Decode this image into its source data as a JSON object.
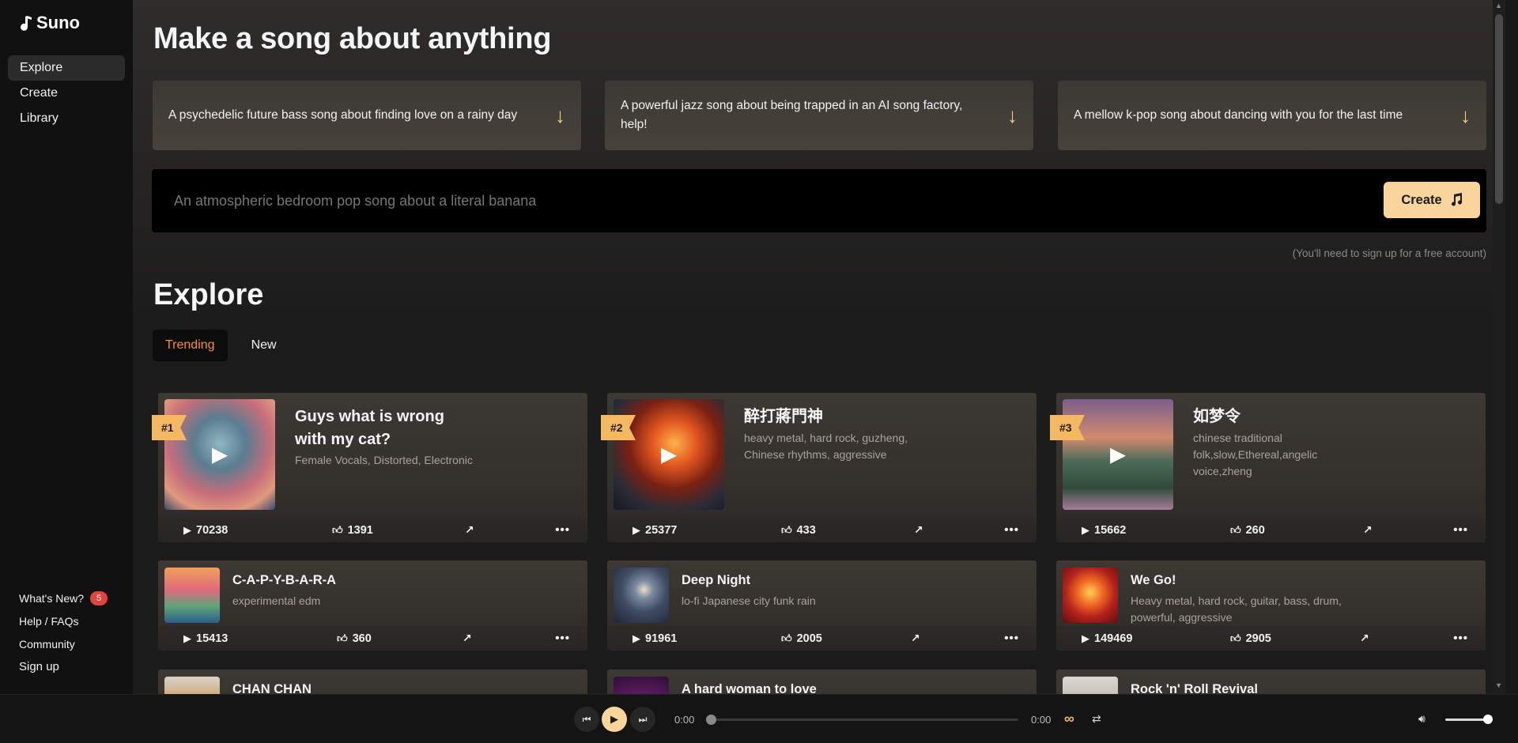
{
  "app": {
    "name": "Suno"
  },
  "sidebar": {
    "items": [
      {
        "label": "Explore",
        "active": true
      },
      {
        "label": "Create"
      },
      {
        "label": "Library"
      }
    ],
    "bottom": {
      "whats_new": "What's New?",
      "whats_new_count": "5",
      "help": "Help / FAQs",
      "community": "Community",
      "signup": "Sign up"
    }
  },
  "hero": {
    "title": "Make a song about anything",
    "prompts": [
      "A psychedelic future bass song about finding love on a rainy day",
      "A powerful jazz song about being trapped in an AI song factory, help!",
      "A mellow k-pop song about dancing with you for the last time"
    ],
    "input_placeholder": "An atmospheric bedroom pop song about a literal banana",
    "create_label": "Create",
    "signup_note": "(You'll need to sign up for a free account)"
  },
  "explore": {
    "title": "Explore",
    "tabs": [
      {
        "label": "Trending",
        "active": true
      },
      {
        "label": "New"
      }
    ],
    "featured": [
      {
        "rank": "#1",
        "title": "Guys what is wrong with my cat?",
        "tags": "Female Vocals, Distorted, Electronic",
        "plays": "70238",
        "likes": "1391"
      },
      {
        "rank": "#2",
        "title": "醉打蔣門神",
        "tags": "heavy metal, hard rock, guzheng, Chinese rhythms, aggressive",
        "plays": "25377",
        "likes": "433"
      },
      {
        "rank": "#3",
        "title": "如梦令",
        "tags": "chinese traditional folk,slow,Ethereal,angelic voice,zheng",
        "plays": "15662",
        "likes": "260"
      }
    ],
    "songs": [
      {
        "title": "C-A-P-Y-B-A-R-A",
        "tags": "experimental edm",
        "plays": "15413",
        "likes": "360"
      },
      {
        "title": "Deep Night",
        "tags": "lo-fi Japanese city funk rain",
        "plays": "91961",
        "likes": "2005"
      },
      {
        "title": "We Go!",
        "tags": "Heavy metal, hard rock, guitar, bass, drum, powerful, aggressive",
        "plays": "149469",
        "likes": "2905"
      },
      {
        "title": "CHAN CHAN",
        "tags": "",
        "plays": "",
        "likes": ""
      },
      {
        "title": "A hard woman to love",
        "tags": "",
        "plays": "",
        "likes": ""
      },
      {
        "title": "Rock 'n' Roll Revival",
        "tags": "",
        "plays": "",
        "likes": ""
      }
    ]
  },
  "player": {
    "current_time": "0:00",
    "duration": "0:00",
    "progress": 0,
    "volume": 1.0
  },
  "colors": {
    "accent": "#fad59b",
    "rank_badge": "#f4b860",
    "active_tab": "#f7941d",
    "badge_red": "#e0443e"
  },
  "icons": {
    "logo": "music-note-icon",
    "prompt_arrow": "arrow-down-icon",
    "create": "music-note-icon",
    "play": "play-icon",
    "like": "thumbs-up-icon",
    "share": "share-icon",
    "more": "more-dots-icon"
  }
}
